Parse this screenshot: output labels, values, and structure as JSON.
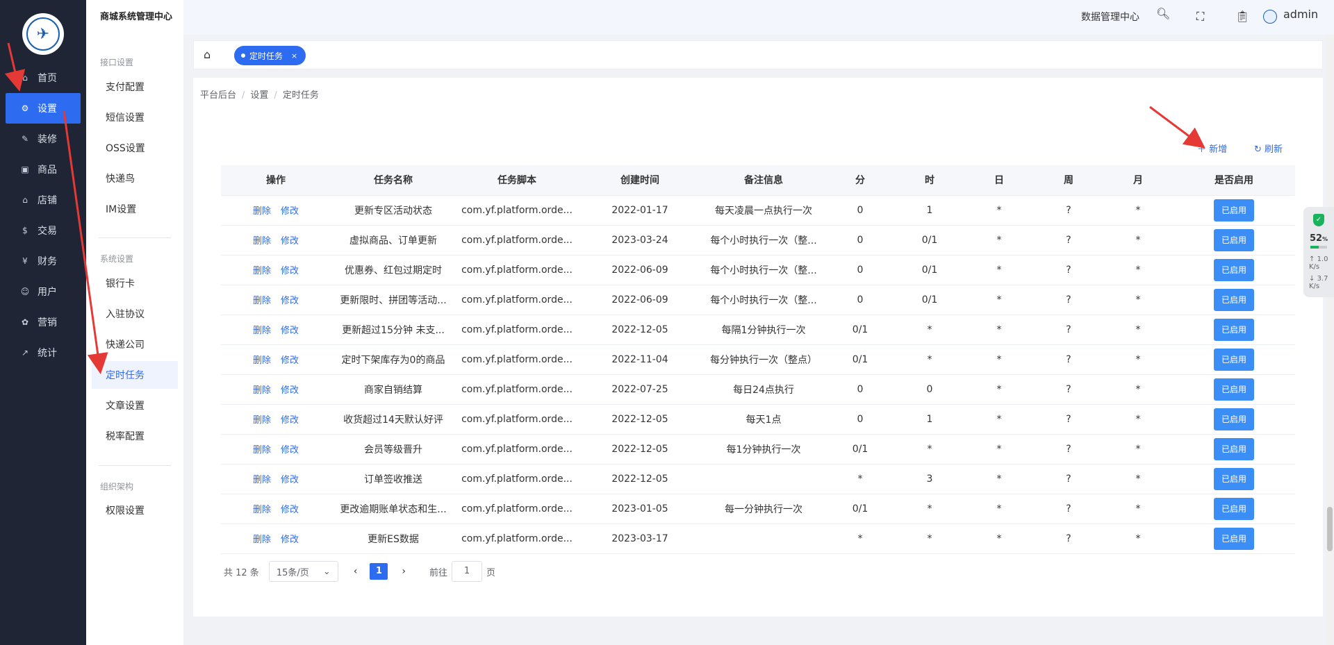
{
  "app": {
    "title": "商城系统管理中心"
  },
  "topbar": {
    "data_center": "数据管理中心",
    "user": "admin"
  },
  "sidebar": {
    "items": [
      {
        "label": "首页",
        "icon": "home-icon"
      },
      {
        "label": "设置",
        "icon": "gear-icon",
        "active": true
      },
      {
        "label": "装修",
        "icon": "decor-icon"
      },
      {
        "label": "商品",
        "icon": "goods-icon"
      },
      {
        "label": "店铺",
        "icon": "store-icon"
      },
      {
        "label": "交易",
        "icon": "trade-icon"
      },
      {
        "label": "财务",
        "icon": "finance-icon"
      },
      {
        "label": "用户",
        "icon": "user-icon"
      },
      {
        "label": "营销",
        "icon": "marketing-icon"
      },
      {
        "label": "统计",
        "icon": "stats-icon"
      }
    ]
  },
  "subnav": {
    "group1": "接口设置",
    "group1_items": [
      "支付配置",
      "短信设置",
      "OSS设置",
      "快递鸟",
      "IM设置"
    ],
    "group2": "系统设置",
    "group2_items": [
      "银行卡",
      "入驻协议",
      "快递公司",
      "定时任务",
      "文章设置",
      "税率配置"
    ],
    "group3": "组织架构",
    "group3_items": [
      "权限设置"
    ]
  },
  "tabs": {
    "active": "定时任务"
  },
  "breadcrumb": [
    "平台后台",
    "设置",
    "定时任务"
  ],
  "actions": {
    "add": "新增",
    "refresh": "刷新"
  },
  "table": {
    "headers": [
      "操作",
      "任务名称",
      "任务脚本",
      "创建时间",
      "备注信息",
      "分",
      "时",
      "日",
      "周",
      "月",
      "是否启用"
    ],
    "delete_label": "删除",
    "edit_label": "修改",
    "rows": [
      {
        "name": "更新专区活动状态",
        "script": "com.yf.platform.orde...",
        "created": "2022-01-17",
        "note": "每天凌晨一点执行一次",
        "min": "0",
        "hour": "1",
        "day": "*",
        "week": "?",
        "month": "*",
        "status": "已启用"
      },
      {
        "name": "虚拟商品、订单更新",
        "script": "com.yf.platform.orde...",
        "created": "2023-03-24",
        "note": "每个小时执行一次（整...",
        "min": "0",
        "hour": "0/1",
        "day": "*",
        "week": "?",
        "month": "*",
        "status": "已启用"
      },
      {
        "name": "优惠券、红包过期定时",
        "script": "com.yf.platform.orde...",
        "created": "2022-06-09",
        "note": "每个小时执行一次（整...",
        "min": "0",
        "hour": "0/1",
        "day": "*",
        "week": "?",
        "month": "*",
        "status": "已启用"
      },
      {
        "name": "更新限时、拼团等活动...",
        "script": "com.yf.platform.orde...",
        "created": "2022-06-09",
        "note": "每个小时执行一次（整...",
        "min": "0",
        "hour": "0/1",
        "day": "*",
        "week": "?",
        "month": "*",
        "status": "已启用"
      },
      {
        "name": "更新超过15分钟 未支...",
        "script": "com.yf.platform.orde...",
        "created": "2022-12-05",
        "note": "每隔1分钟执行一次",
        "min": "0/1",
        "hour": "*",
        "day": "*",
        "week": "?",
        "month": "*",
        "status": "已启用"
      },
      {
        "name": "定时下架库存为0的商品",
        "script": "com.yf.platform.orde...",
        "created": "2022-11-04",
        "note": "每分钟执行一次（整点）",
        "min": "0/1",
        "hour": "*",
        "day": "*",
        "week": "?",
        "month": "*",
        "status": "已启用"
      },
      {
        "name": "商家自销结算",
        "script": "com.yf.platform.orde...",
        "created": "2022-07-25",
        "note": "每日24点执行",
        "min": "0",
        "hour": "0",
        "day": "*",
        "week": "?",
        "month": "*",
        "status": "已启用"
      },
      {
        "name": "收货超过14天默认好评",
        "script": "com.yf.platform.orde...",
        "created": "2022-12-05",
        "note": "每天1点",
        "min": "0",
        "hour": "1",
        "day": "*",
        "week": "?",
        "month": "*",
        "status": "已启用"
      },
      {
        "name": "会员等级晋升",
        "script": "com.yf.platform.orde...",
        "created": "2022-12-05",
        "note": "每1分钟执行一次",
        "min": "0/1",
        "hour": "*",
        "day": "*",
        "week": "?",
        "month": "*",
        "status": "已启用"
      },
      {
        "name": "订单签收推送",
        "script": "com.yf.platform.orde...",
        "created": "2022-12-05",
        "note": "",
        "min": "*",
        "hour": "3",
        "day": "*",
        "week": "?",
        "month": "*",
        "status": "已启用"
      },
      {
        "name": "更改逾期账单状态和生...",
        "script": "com.yf.platform.orde...",
        "created": "2023-01-05",
        "note": "每一分钟执行一次",
        "min": "0/1",
        "hour": "*",
        "day": "*",
        "week": "?",
        "month": "*",
        "status": "已启用"
      },
      {
        "name": "更新ES数据",
        "script": "com.yf.platform.orde...",
        "created": "2023-03-17",
        "note": "",
        "min": "*",
        "hour": "*",
        "day": "*",
        "week": "?",
        "month": "*",
        "status": "已启用"
      }
    ]
  },
  "pagination": {
    "total_label": "共 12 条",
    "page_size": "15条/页",
    "current": "1",
    "goto_label": "前往",
    "goto_value": "1",
    "page_suffix": "页"
  },
  "widget": {
    "percent": "52",
    "percent_unit": "%",
    "up": "1.0",
    "down": "3.7",
    "unit": "K/s"
  },
  "colors": {
    "primary": "#2d6bf0",
    "sidebar_bg": "#1f2535",
    "button": "#3a8ef6"
  }
}
